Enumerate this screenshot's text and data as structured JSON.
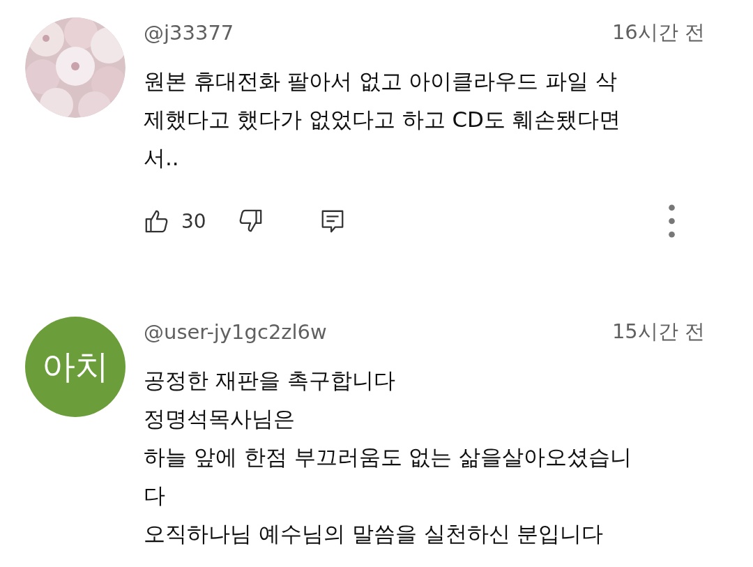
{
  "comments": [
    {
      "author": "@j33377",
      "time": "16시간 전",
      "lines": [
        "원본 휴대전화 팔아서 없고 아이클라우드 파일 삭",
        "제했다고 했다가 없었다고 하고 CD도 훼손됐다면",
        "서.."
      ],
      "likes": "30"
    },
    {
      "author": "@user-jy1gc2zl6w",
      "time": "15시간 전",
      "avatar": {
        "kind": "initials",
        "text": "아치",
        "color": "#6b9e3a"
      },
      "lines": [
        "공정한 재판을 촉구합니다",
        "정명석목사님은",
        "하늘 앞에 한점 부끄러움도 없는 삶을살아오셨습니",
        "다",
        "오직하나님 예수님의 말씀을 실천하신 분입니다"
      ]
    }
  ]
}
